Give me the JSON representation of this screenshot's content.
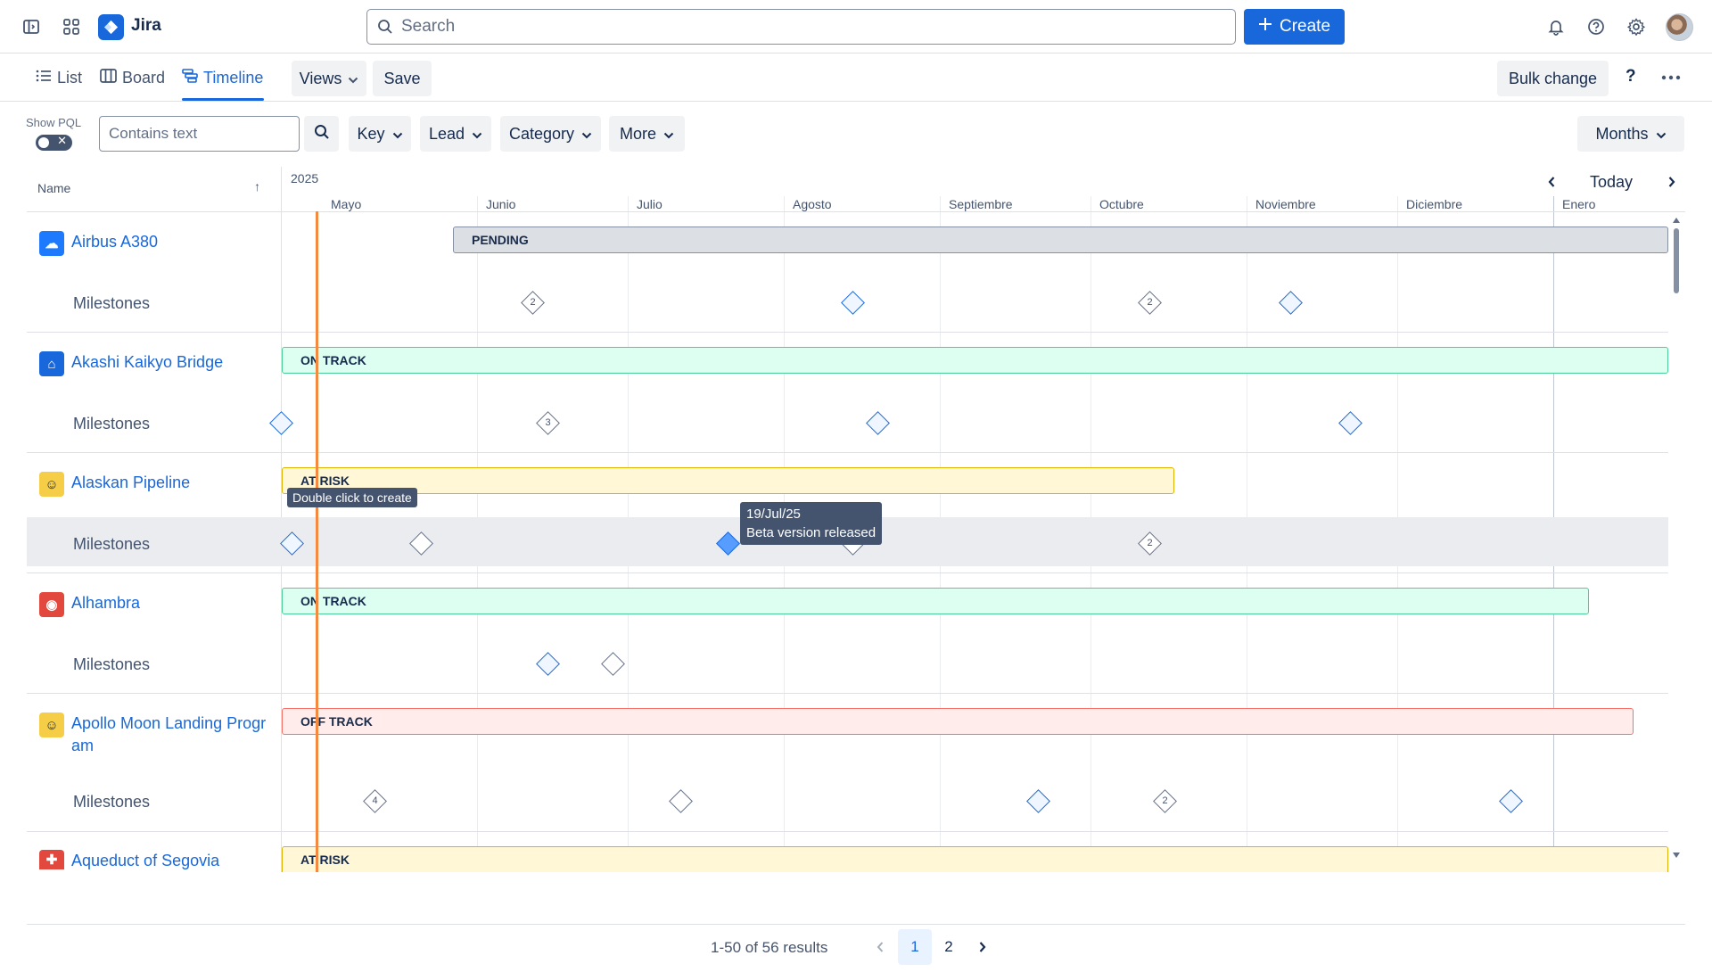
{
  "topbar": {
    "app_name": "Jira",
    "search_placeholder": "Search",
    "create_label": "Create",
    "icons": [
      "sidebar-toggle-icon",
      "app-switcher-icon",
      "bell-icon",
      "help-icon",
      "gear-icon"
    ]
  },
  "views": {
    "tabs": [
      {
        "label": "List",
        "icon": "list-icon"
      },
      {
        "label": "Board",
        "icon": "board-icon"
      },
      {
        "label": "Timeline",
        "icon": "timeline-icon",
        "active": true
      }
    ],
    "views_label": "Views",
    "save_label": "Save",
    "bulk_change_label": "Bulk change",
    "help_label": "?"
  },
  "filters": {
    "show_pql_label": "Show PQL",
    "text_placeholder": "Contains text",
    "dropdowns": [
      "Key",
      "Lead",
      "Category",
      "More"
    ],
    "scale_label": "Months"
  },
  "timeline": {
    "name_header": "Name",
    "year": "2025",
    "months": [
      "Mayo",
      "Junio",
      "Julio",
      "Agosto",
      "Septiembre",
      "Octubre",
      "Noviembre",
      "Diciembre",
      "Enero"
    ],
    "today_label": "Today",
    "milestones_label": "Milestones",
    "projects": [
      {
        "name": "Airbus A380",
        "status": "PENDING",
        "icon_color": "#1d7afc",
        "milestone_counts": [
          "2",
          "2"
        ]
      },
      {
        "name": "Akashi Kaikyo Bridge",
        "status": "ON TRACK",
        "icon_color": "#1868db",
        "milestone_counts": [
          "3"
        ]
      },
      {
        "name": "Alaskan Pipeline",
        "status": "AT RISK",
        "icon_color": "#f5cd47",
        "milestone_counts": [
          "2"
        ]
      },
      {
        "name": "Alhambra",
        "status": "ON TRACK",
        "icon_color": "#e2483d",
        "milestone_counts": []
      },
      {
        "name": "Apollo Moon Landing Program",
        "name_line1": "Apollo Moon Landing Progr",
        "name_line2": "am",
        "status": "OFF TRACK",
        "icon_color": "#f5cd47",
        "milestone_counts": [
          "4",
          "2"
        ]
      },
      {
        "name": "Aqueduct of Segovia",
        "status": "AT RISK",
        "icon_color": "#e2483d",
        "milestone_counts": []
      }
    ],
    "hint_tooltip": "Double click to create",
    "milestone_tooltip": {
      "date": "19/Jul/25",
      "title": "Beta version released"
    }
  },
  "pagination": {
    "results_text": "1-50 of 56 results",
    "pages": [
      "1",
      "2"
    ],
    "current_page": "1"
  }
}
